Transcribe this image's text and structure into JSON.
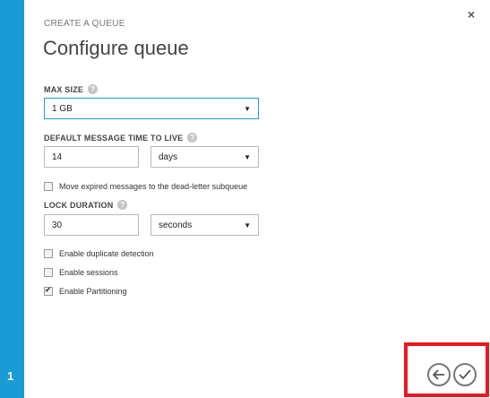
{
  "header": {
    "subtitle": "CREATE A QUEUE",
    "title": "Configure queue",
    "close_glyph": "×"
  },
  "rail": {
    "step": "1"
  },
  "form": {
    "max_size": {
      "label": "MAX SIZE",
      "help": "?",
      "value": "1 GB",
      "arrow": "▼"
    },
    "ttl": {
      "label": "DEFAULT MESSAGE TIME TO LIVE",
      "help": "?",
      "value": "14",
      "unit": "days",
      "arrow": "▼"
    },
    "dead_letter": {
      "label": "Move expired messages to the dead-letter subqueue",
      "checked": false
    },
    "lock": {
      "label": "LOCK DURATION",
      "help": "?",
      "value": "30",
      "unit": "seconds",
      "arrow": "▼"
    },
    "duplicate": {
      "label": "Enable duplicate detection",
      "checked": false
    },
    "sessions": {
      "label": "Enable sessions",
      "checked": false
    },
    "partitioning": {
      "label": "Enable Partitioning",
      "checked": true
    }
  },
  "footer": {
    "back_icon": "back-arrow-icon",
    "ok_icon": "checkmark-icon"
  },
  "colors": {
    "accent": "#1a9bd6",
    "highlight": "#e8191f"
  }
}
